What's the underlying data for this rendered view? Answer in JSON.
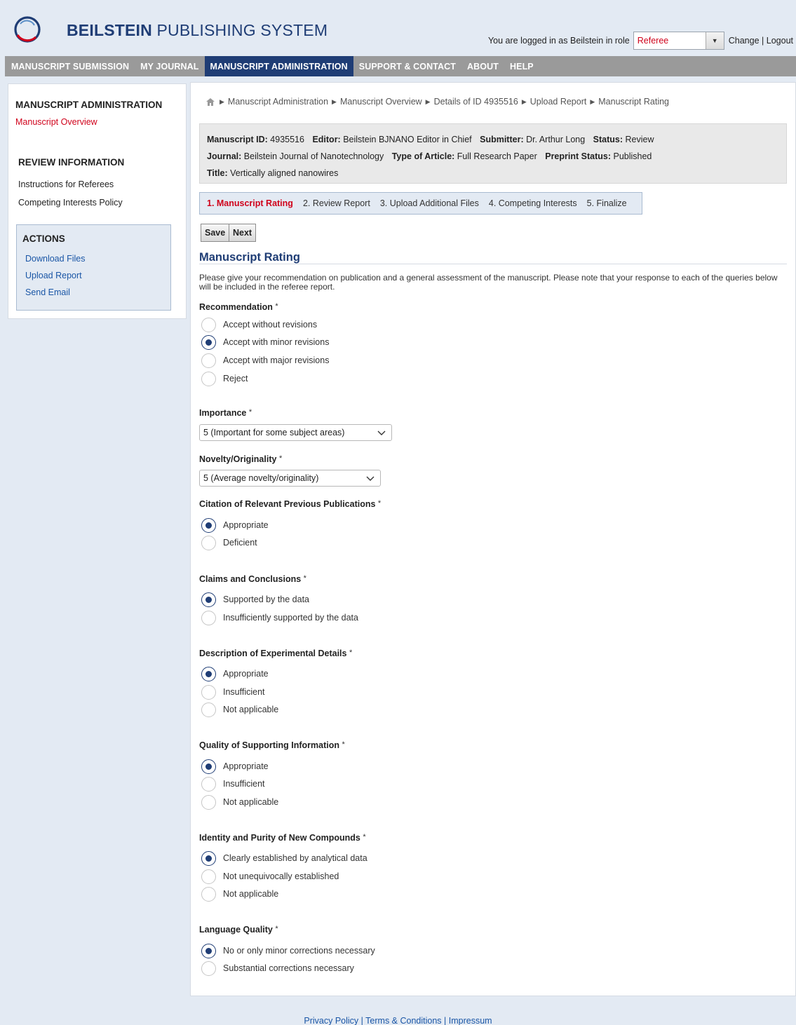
{
  "brand": {
    "bold": "BEILSTEIN",
    "rest": " PUBLISHING SYSTEM"
  },
  "login": {
    "text": "You are logged in as Beilstein in role",
    "role": "Referee",
    "change": "Change",
    "separator": "|",
    "logout": "Logout"
  },
  "nav": {
    "items": [
      "MANUSCRIPT SUBMISSION",
      "MY JOURNAL",
      "MANUSCRIPT ADMINISTRATION",
      "SUPPORT & CONTACT",
      "ABOUT",
      "HELP"
    ],
    "active": "MANUSCRIPT ADMINISTRATION"
  },
  "sidebar": {
    "admin_heading": "MANUSCRIPT ADMINISTRATION",
    "overview_link": "Manuscript Overview",
    "review_heading": "REVIEW INFORMATION",
    "review_links": [
      "Instructions for Referees",
      "Competing Interests Policy"
    ],
    "actions_heading": "ACTIONS",
    "actions": [
      "Download Files",
      "Upload Report",
      "Send Email"
    ]
  },
  "breadcrumb": [
    "Manuscript Administration",
    "Manuscript Overview",
    "Details of ID 4935516",
    "Upload Report",
    "Manuscript Rating"
  ],
  "manuscript": {
    "id_label": "Manuscript ID:",
    "id": "4935516",
    "editor_label": "Editor:",
    "editor": "Beilstein BJNANO Editor in Chief",
    "submitter_label": "Submitter:",
    "submitter": "Dr. Arthur Long",
    "status_label": "Status:",
    "status": "Review",
    "journal_label": "Journal:",
    "journal": "Beilstein Journal of Nanotechnology",
    "type_label": "Type of Article:",
    "type": "Full Research Paper",
    "preprint_label": "Preprint Status:",
    "preprint": "Published",
    "title_label": "Title:",
    "title": "Vertically aligned nanowires"
  },
  "steps": [
    "1. Manuscript Rating",
    "2. Review Report",
    "3. Upload Additional Files",
    "4. Competing Interests",
    "5. Finalize"
  ],
  "buttons": {
    "save": "Save",
    "next": "Next"
  },
  "section": {
    "title": "Manuscript Rating",
    "intro": "Please give your recommendation on publication and a general assessment of the manuscript. Please note that your response to each of the queries below will be included in the referee report."
  },
  "required_mark": "*",
  "questions": {
    "recommendation": {
      "label": "Recommendation",
      "options": [
        "Accept without revisions",
        "Accept with minor revisions",
        "Accept with major revisions",
        "Reject"
      ],
      "selected": "Accept with minor revisions"
    },
    "importance": {
      "label": "Importance",
      "value": "5 (Important for some subject areas)"
    },
    "novelty": {
      "label": "Novelty/Originality",
      "value": "5 (Average novelty/originality)"
    },
    "citation": {
      "label": "Citation of Relevant Previous Publications",
      "options": [
        "Appropriate",
        "Deficient"
      ],
      "selected": "Appropriate"
    },
    "claims": {
      "label": "Claims and Conclusions",
      "options": [
        "Supported by the data",
        "Insufficiently supported by the data"
      ],
      "selected": "Supported by the data"
    },
    "experimental": {
      "label": "Description of Experimental Details",
      "options": [
        "Appropriate",
        "Insufficient",
        "Not applicable"
      ],
      "selected": "Appropriate"
    },
    "supporting": {
      "label": "Quality of Supporting Information",
      "options": [
        "Appropriate",
        "Insufficient",
        "Not applicable"
      ],
      "selected": "Appropriate"
    },
    "compounds": {
      "label": "Identity and Purity of New Compounds",
      "options": [
        "Clearly established by analytical data",
        "Not unequivocally established",
        "Not applicable"
      ],
      "selected": "Clearly established by analytical data"
    },
    "language": {
      "label": "Language Quality",
      "options": [
        "No or only minor corrections necessary",
        "Substantial corrections necessary"
      ],
      "selected": "No or only minor corrections necessary"
    }
  },
  "footer": {
    "links": [
      "Privacy Policy",
      "Terms & Conditions",
      "Impressum"
    ],
    "separator": "|"
  },
  "colors": {
    "brand_blue": "#1f3d75",
    "accent_red": "#d0021b",
    "link_blue": "#1a56a6",
    "nav_gray": "#9a9a9a",
    "page_bg": "#e3eaf3"
  },
  "icons": [
    "logo-icon",
    "home-icon",
    "breadcrumb-arrow-icon",
    "dropdown-arrow-icon",
    "chevron-down-icon"
  ]
}
